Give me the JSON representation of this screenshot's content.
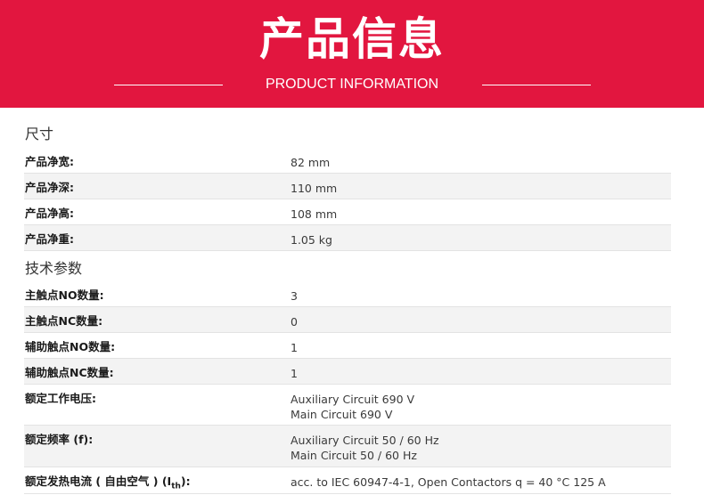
{
  "banner": {
    "title": "产品信息",
    "subtitle": "PRODUCT INFORMATION"
  },
  "sections": [
    {
      "title": "尺寸",
      "rows": [
        {
          "label": "产品净宽:",
          "value": "82 mm"
        },
        {
          "label": "产品净深:",
          "value": "110 mm"
        },
        {
          "label": "产品净高:",
          "value": "108 mm"
        },
        {
          "label": "产品净重:",
          "value": "1.05 kg"
        }
      ]
    },
    {
      "title": "技术参数",
      "rows": [
        {
          "label": "主触点NO数量:",
          "value": "3"
        },
        {
          "label": "主触点NC数量:",
          "value": "0"
        },
        {
          "label": "辅助触点NO数量:",
          "value": "1"
        },
        {
          "label": "辅助触点NC数量:",
          "value": "1"
        },
        {
          "label": "额定工作电压:",
          "value_lines": [
            "Auxiliary Circuit 690 V",
            "Main Circuit 690 V"
          ]
        },
        {
          "label": "额定频率 (f):",
          "value_lines": [
            "Auxiliary Circuit 50 / 60 Hz",
            "Main Circuit 50 / 60 Hz"
          ]
        },
        {
          "label_main": "额定发热电流 ( 自由空气 ) (I",
          "label_sub": "th",
          "label_tail": "):",
          "value": "acc. to IEC 60947-4-1, Open Contactors q = 40 °C 125 A"
        }
      ]
    }
  ]
}
